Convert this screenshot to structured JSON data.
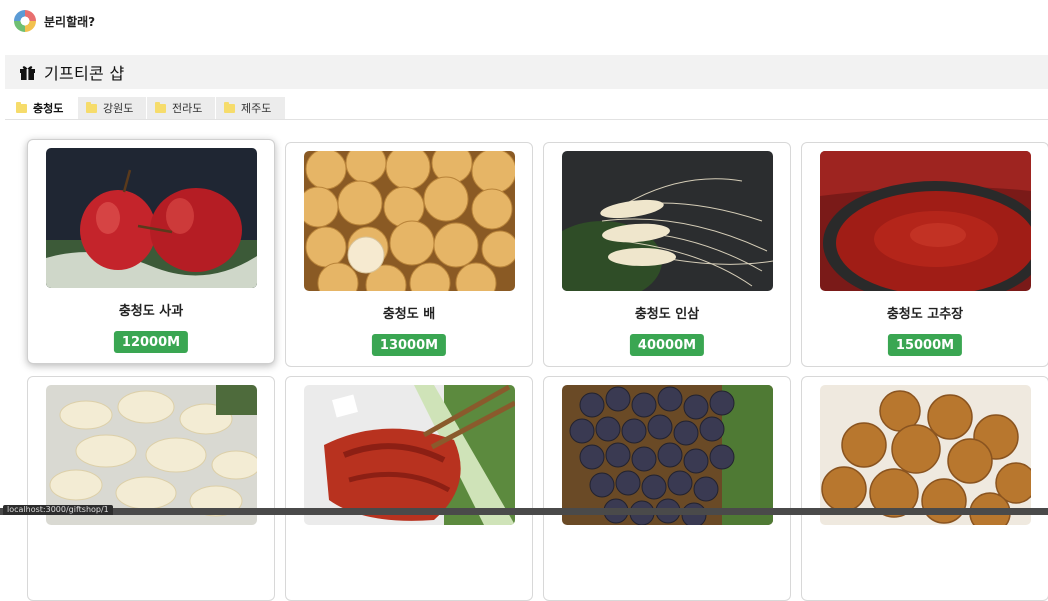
{
  "app": {
    "title": "분리할래?",
    "logo_icon": "recycle-logo-icon"
  },
  "section": {
    "title": "기프티콘 샵",
    "icon": "gift-icon"
  },
  "tabs": [
    {
      "label": "충청도",
      "active": true
    },
    {
      "label": "강원도",
      "active": false
    },
    {
      "label": "전라도",
      "active": false
    },
    {
      "label": "제주도",
      "active": false
    }
  ],
  "products": [
    {
      "name": "충청도 사과",
      "price": "12000M"
    },
    {
      "name": "충청도 배",
      "price": "13000M"
    },
    {
      "name": "충청도 인삼",
      "price": "40000M"
    },
    {
      "name": "충청도 고추장",
      "price": "15000M"
    },
    {
      "name": "",
      "price": ""
    },
    {
      "name": "",
      "price": ""
    },
    {
      "name": "",
      "price": ""
    },
    {
      "name": "",
      "price": ""
    }
  ],
  "status": {
    "url": "localhost:3000/giftshop/1"
  },
  "colors": {
    "price_badge": "#3aa652",
    "section_bar": "#f2f2f2",
    "folder": "#f6dc6b"
  }
}
